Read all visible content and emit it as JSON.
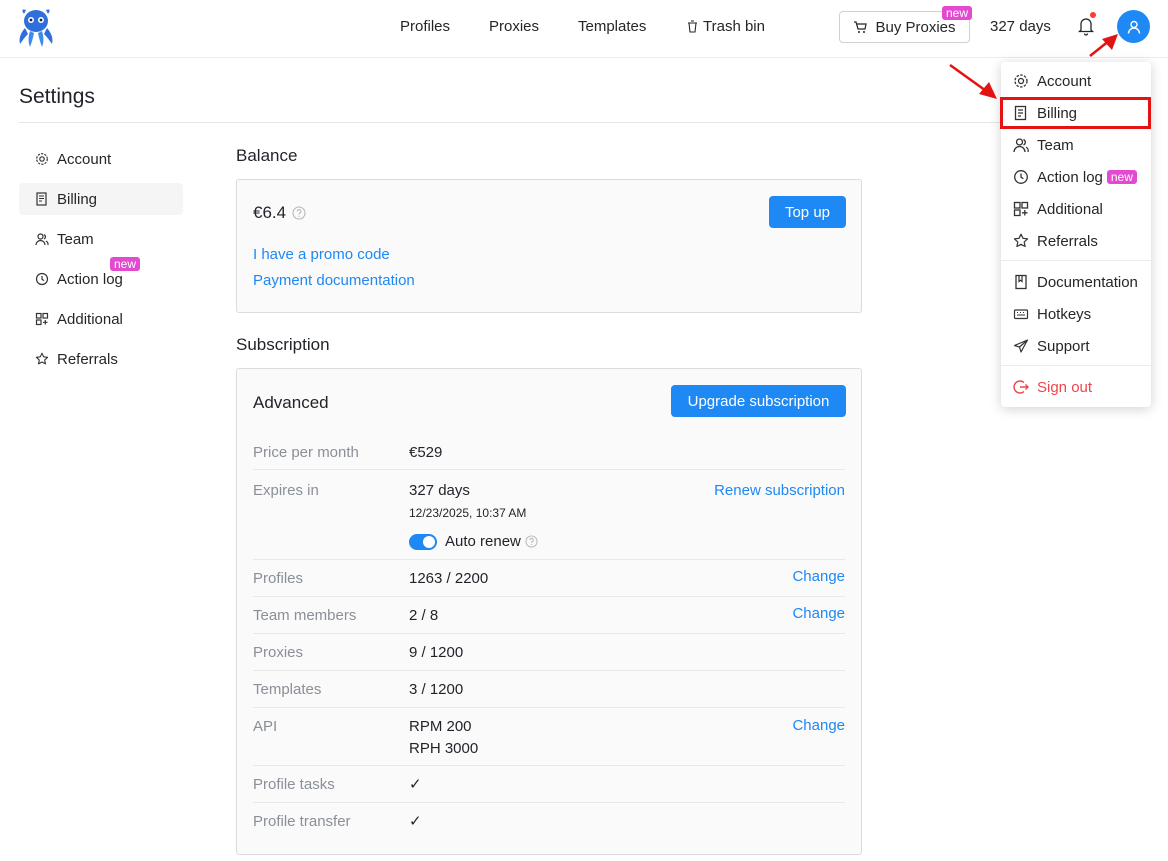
{
  "topbar": {
    "logo": "octopus-logo",
    "nav": [
      {
        "label": "Profiles"
      },
      {
        "label": "Proxies"
      },
      {
        "label": "Templates"
      },
      {
        "label": "Trash bin",
        "icon": "trash-icon"
      }
    ],
    "buy_proxies": {
      "label": "Buy Proxies",
      "badge": "new",
      "icon": "cart-icon"
    },
    "days_left": "327 days",
    "bell_icon": "bell-icon",
    "avatar_icon": "user-icon"
  },
  "page": {
    "title": "Settings"
  },
  "sidebar": {
    "items": [
      {
        "label": "Account",
        "icon": "gear-icon"
      },
      {
        "label": "Billing",
        "icon": "receipt-icon",
        "active": true
      },
      {
        "label": "Team",
        "icon": "team-icon"
      },
      {
        "label": "Action log",
        "icon": "history-icon",
        "badge": "new"
      },
      {
        "label": "Additional",
        "icon": "grid-icon"
      },
      {
        "label": "Referrals",
        "icon": "star-icon"
      }
    ]
  },
  "balance": {
    "section_title": "Balance",
    "amount": "€6.4",
    "topup_label": "Top up",
    "promo_link": "I have a promo code",
    "payment_doc_link": "Payment documentation"
  },
  "subscription": {
    "section_title": "Subscription",
    "plan": "Advanced",
    "upgrade_label": "Upgrade subscription",
    "rows": {
      "price": {
        "label": "Price per month",
        "value": "€529"
      },
      "expires": {
        "label": "Expires in",
        "value": "327 days",
        "date": "12/23/2025, 10:37 AM",
        "action": "Renew subscription",
        "auto_renew_label": "Auto renew",
        "auto_renew_on": true
      },
      "profiles": {
        "label": "Profiles",
        "value": "1263 / 2200",
        "action": "Change"
      },
      "team": {
        "label": "Team members",
        "value": "2 / 8",
        "action": "Change"
      },
      "proxies": {
        "label": "Proxies",
        "value": "9 / 1200"
      },
      "templates": {
        "label": "Templates",
        "value": "3 / 1200"
      },
      "api": {
        "label": "API",
        "value_rpm": "RPM 200",
        "value_rph": "RPH 3000",
        "action": "Change"
      },
      "profile_tasks": {
        "label": "Profile tasks",
        "value": "✓"
      },
      "profile_transfer": {
        "label": "Profile transfer",
        "value": "✓"
      }
    }
  },
  "menu": {
    "items": [
      {
        "label": "Account",
        "icon": "gear-icon"
      },
      {
        "label": "Billing",
        "icon": "receipt-icon",
        "highlighted": true
      },
      {
        "label": "Team",
        "icon": "team-icon"
      },
      {
        "label": "Action log",
        "icon": "history-icon",
        "badge": "new"
      },
      {
        "label": "Additional",
        "icon": "grid-icon"
      },
      {
        "label": "Referrals",
        "icon": "star-icon"
      },
      {
        "label": "Documentation",
        "icon": "book-icon"
      },
      {
        "label": "Hotkeys",
        "icon": "keyboard-icon"
      },
      {
        "label": "Support",
        "icon": "send-icon"
      },
      {
        "label": "Sign out",
        "icon": "sign-out-icon"
      }
    ]
  },
  "colors": {
    "accent": "#1e88f4",
    "badge": "#e24bd1",
    "danger": "#f0454d",
    "annotation": "#e31313"
  }
}
